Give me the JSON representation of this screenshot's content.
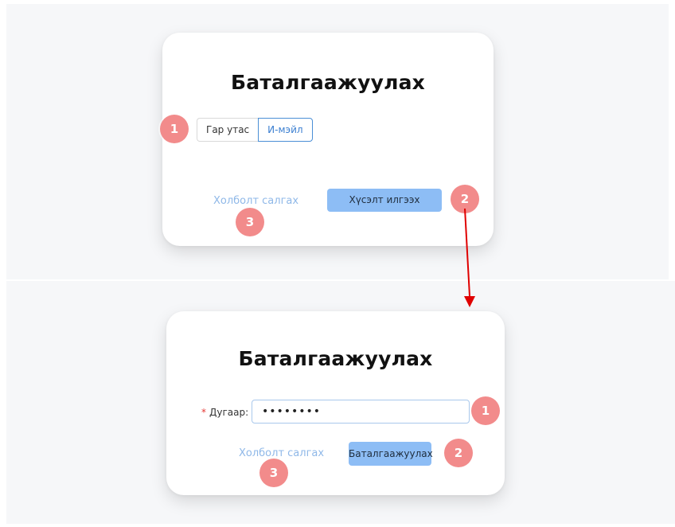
{
  "step1": {
    "title": "Баталгаажуулах",
    "tabs": [
      {
        "label": "Гар утас",
        "active": false
      },
      {
        "label": "И-мэйл",
        "active": true
      }
    ],
    "disconnect_link": "Холболт салгах",
    "submit_button": "Хүсэлт илгээх",
    "badges": [
      "1",
      "2",
      "3"
    ]
  },
  "step2": {
    "title": "Баталгаажуулах",
    "field_required_mark": "*",
    "field_label": "Дугаар",
    "field_colon": ":",
    "field_value": "••••••••",
    "disconnect_link": "Холболт салгах",
    "verify_button": "Баталгаажуулах",
    "badges": [
      "1",
      "2",
      "3"
    ]
  },
  "colors": {
    "badge": "#f28b8b",
    "primary_button": "#8dbdf5",
    "link": "#8fb8e8",
    "arrow": "#e00000",
    "active_tab_border": "#4b8fd6"
  }
}
